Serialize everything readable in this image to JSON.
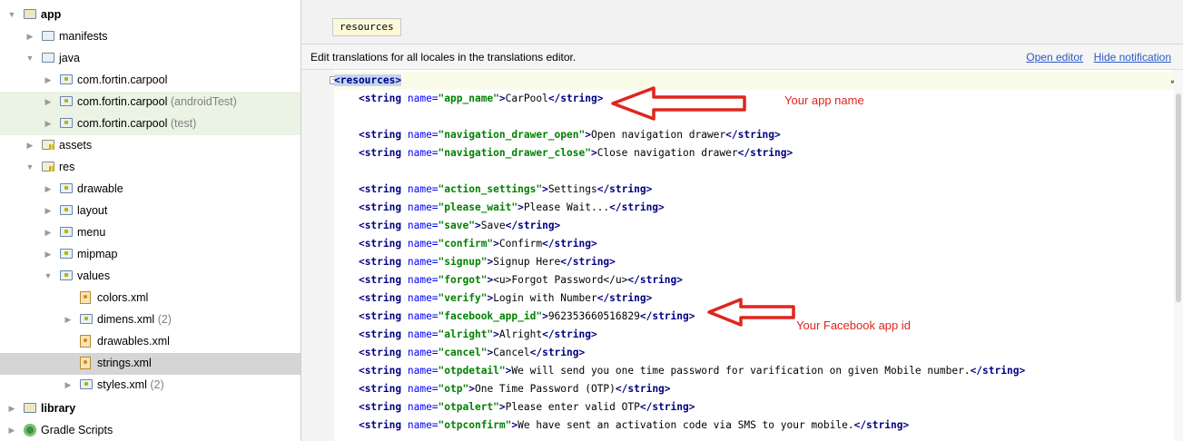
{
  "tree": [
    {
      "label": "app",
      "bold": true,
      "icon": "module",
      "arrow": "expanded",
      "indent": 0,
      "state": ""
    },
    {
      "label": "manifests",
      "icon": "folder",
      "arrow": "collapsed",
      "indent": 1,
      "state": ""
    },
    {
      "label": "java",
      "icon": "folder",
      "arrow": "expanded",
      "indent": 1,
      "state": ""
    },
    {
      "label": "com.fortin.carpool",
      "icon": "package",
      "arrow": "collapsed",
      "indent": 2,
      "state": ""
    },
    {
      "label": "com.fortin.carpool",
      "suffix": " (androidTest)",
      "icon": "package",
      "arrow": "collapsed",
      "indent": 2,
      "state": "hl"
    },
    {
      "label": "com.fortin.carpool",
      "suffix": " (test)",
      "icon": "package",
      "arrow": "collapsed",
      "indent": 2,
      "state": "hl"
    },
    {
      "label": "assets",
      "icon": "res-folder",
      "arrow": "collapsed",
      "indent": 1,
      "state": ""
    },
    {
      "label": "res",
      "icon": "res-folder",
      "arrow": "expanded",
      "indent": 1,
      "state": ""
    },
    {
      "label": "drawable",
      "icon": "package",
      "arrow": "collapsed",
      "indent": 2,
      "state": ""
    },
    {
      "label": "layout",
      "icon": "package",
      "arrow": "collapsed",
      "indent": 2,
      "state": ""
    },
    {
      "label": "menu",
      "icon": "package",
      "arrow": "collapsed",
      "indent": 2,
      "state": ""
    },
    {
      "label": "mipmap",
      "icon": "package",
      "arrow": "collapsed",
      "indent": 2,
      "state": ""
    },
    {
      "label": "values",
      "icon": "package",
      "arrow": "expanded",
      "indent": 2,
      "state": ""
    },
    {
      "label": "colors.xml",
      "icon": "xml",
      "arrow": "none",
      "indent": 3,
      "state": ""
    },
    {
      "label": "dimens.xml",
      "suffix": " (2)",
      "icon": "package",
      "arrow": "collapsed",
      "indent": 3,
      "state": ""
    },
    {
      "label": "drawables.xml",
      "icon": "xml",
      "arrow": "none",
      "indent": 3,
      "state": ""
    },
    {
      "label": "strings.xml",
      "icon": "xml",
      "arrow": "none",
      "indent": 3,
      "state": "sel"
    },
    {
      "label": "styles.xml",
      "suffix": " (2)",
      "icon": "package",
      "arrow": "collapsed",
      "indent": 3,
      "state": ""
    },
    {
      "label": "library",
      "bold": true,
      "icon": "library",
      "arrow": "collapsed",
      "indent": 0,
      "state": ""
    },
    {
      "label": "Gradle Scripts",
      "icon": "gradle",
      "arrow": "collapsed",
      "indent": 0,
      "state": ""
    }
  ],
  "editor": {
    "breadcrumb": "resources",
    "notification": "Edit translations for all locales in the translations editor.",
    "open_editor": "Open editor",
    "hide_notification": "Hide notification",
    "code_lines": [
      {
        "type": "open",
        "tag": "resources"
      },
      {
        "type": "string",
        "name": "app_name",
        "value": "CarPool"
      },
      {
        "type": "blank"
      },
      {
        "type": "string",
        "name": "navigation_drawer_open",
        "value": "Open navigation drawer"
      },
      {
        "type": "string",
        "name": "navigation_drawer_close",
        "value": "Close navigation drawer"
      },
      {
        "type": "blank"
      },
      {
        "type": "string",
        "name": "action_settings",
        "value": "Settings"
      },
      {
        "type": "string",
        "name": "please_wait",
        "value": "Please Wait..."
      },
      {
        "type": "string",
        "name": "save",
        "value": "Save"
      },
      {
        "type": "string",
        "name": "confirm",
        "value": "Confirm"
      },
      {
        "type": "string",
        "name": "signup",
        "value": "Signup Here"
      },
      {
        "type": "string",
        "name": "forgot",
        "value": "<u>Forgot Password</u>"
      },
      {
        "type": "string",
        "name": "verify",
        "value": "Login with Number"
      },
      {
        "type": "string",
        "name": "facebook_app_id",
        "value": "962353660516829"
      },
      {
        "type": "string",
        "name": "alright",
        "value": "Alright"
      },
      {
        "type": "string",
        "name": "cancel",
        "value": "Cancel"
      },
      {
        "type": "string",
        "name": "otpdetail",
        "value": "We will send you one time password for varification on given Mobile number."
      },
      {
        "type": "string",
        "name": "otp",
        "value": "One Time Password (OTP)"
      },
      {
        "type": "string",
        "name": "otpalert",
        "value": "Please enter valid OTP"
      },
      {
        "type": "string",
        "name": "otpconfirm",
        "value": "We have sent an activation code via SMS to your mobile."
      }
    ]
  },
  "annotations": {
    "app_name": "Your app name",
    "facebook": "Your Facebook app id"
  },
  "colors": {
    "annotation": "#e0251e",
    "link": "#2b59c3",
    "tag": "#000080",
    "attr": "#0000ff",
    "value": "#008000"
  }
}
